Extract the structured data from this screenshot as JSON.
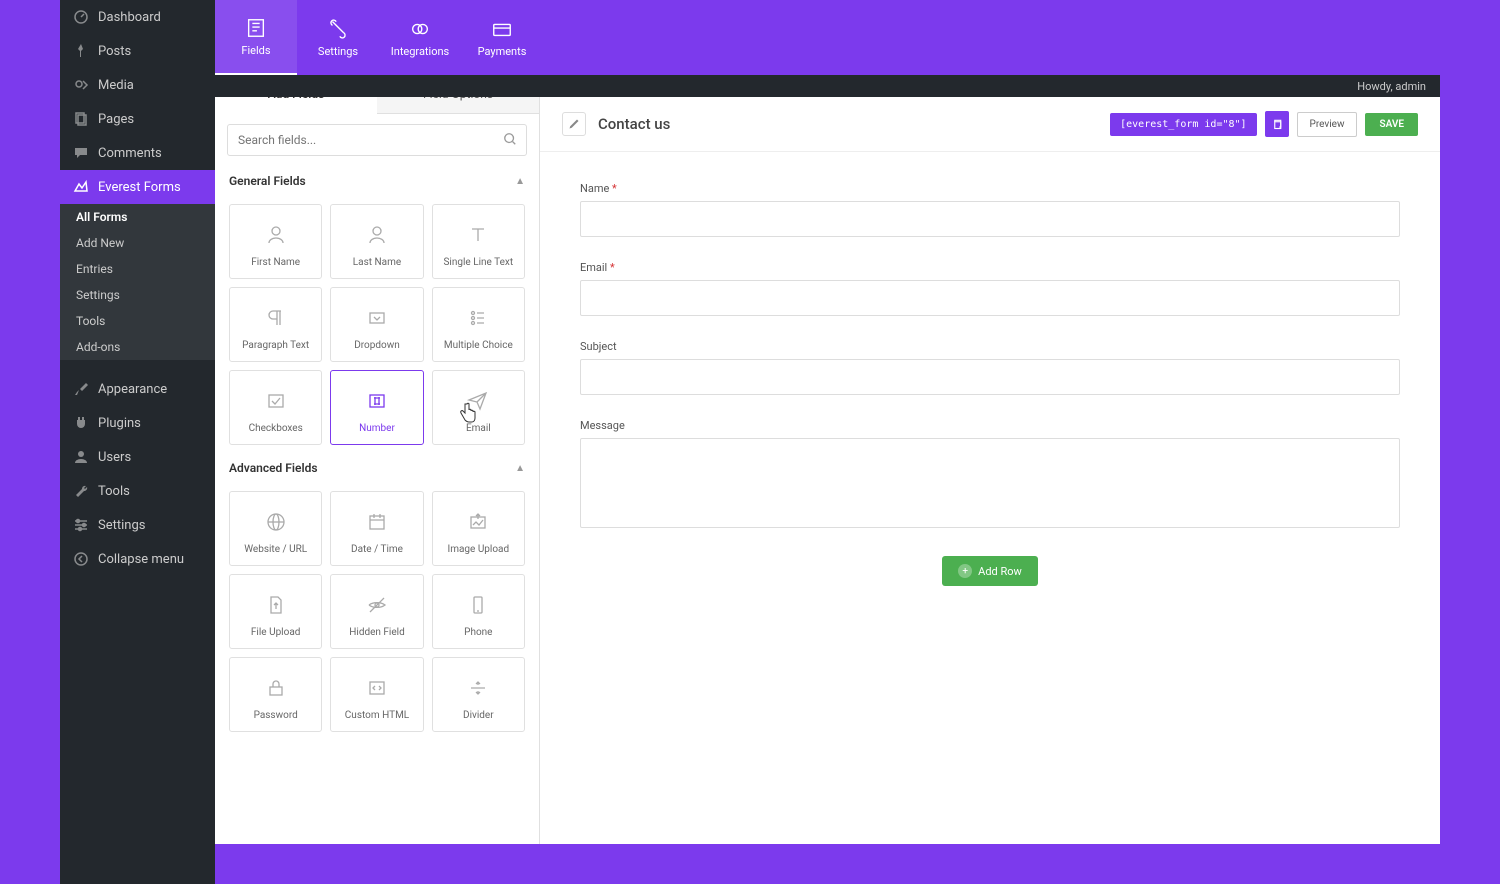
{
  "adminbar": {
    "howdy": "Howdy, admin"
  },
  "wp_sidebar": {
    "items": [
      {
        "label": "Dashboard",
        "icon": "dashboard"
      },
      {
        "label": "Posts",
        "icon": "pin"
      },
      {
        "label": "Media",
        "icon": "media"
      },
      {
        "label": "Pages",
        "icon": "page"
      },
      {
        "label": "Comments",
        "icon": "comment"
      },
      {
        "label": "Everest Forms",
        "icon": "forms",
        "active": true
      },
      {
        "label": "Appearance",
        "icon": "brush"
      },
      {
        "label": "Plugins",
        "icon": "plug"
      },
      {
        "label": "Users",
        "icon": "users"
      },
      {
        "label": "Tools",
        "icon": "wrench"
      },
      {
        "label": "Settings",
        "icon": "sliders"
      },
      {
        "label": "Collapse menu",
        "icon": "collapse"
      }
    ],
    "submenu": [
      {
        "label": "All Forms",
        "active": true
      },
      {
        "label": "Add New"
      },
      {
        "label": "Entries"
      },
      {
        "label": "Settings"
      },
      {
        "label": "Tools"
      },
      {
        "label": "Add-ons"
      }
    ]
  },
  "top_tabs": [
    {
      "label": "Fields",
      "active": true
    },
    {
      "label": "Settings"
    },
    {
      "label": "Integrations"
    },
    {
      "label": "Payments"
    }
  ],
  "fields_panel": {
    "tabs": {
      "add": "Add Fields",
      "options": "Field Options"
    },
    "search_placeholder": "Search fields...",
    "general_header": "General Fields",
    "advanced_header": "Advanced Fields",
    "general": [
      {
        "label": "First Name"
      },
      {
        "label": "Last Name"
      },
      {
        "label": "Single Line Text"
      },
      {
        "label": "Paragraph Text"
      },
      {
        "label": "Dropdown"
      },
      {
        "label": "Multiple Choice"
      },
      {
        "label": "Checkboxes"
      },
      {
        "label": "Number",
        "hover": true
      },
      {
        "label": "Email"
      }
    ],
    "advanced": [
      {
        "label": "Website / URL"
      },
      {
        "label": "Date / Time"
      },
      {
        "label": "Image Upload"
      },
      {
        "label": "File Upload"
      },
      {
        "label": "Hidden Field"
      },
      {
        "label": "Phone"
      },
      {
        "label": "Password"
      },
      {
        "label": "Custom HTML"
      },
      {
        "label": "Divider"
      }
    ]
  },
  "canvas": {
    "title": "Contact us",
    "shortcode": "[everest_form id=\"8\"]",
    "preview": "Preview",
    "save": "SAVE",
    "fields": {
      "name": "Name",
      "email": "Email",
      "subject": "Subject",
      "message": "Message"
    },
    "add_row": "Add Row"
  }
}
